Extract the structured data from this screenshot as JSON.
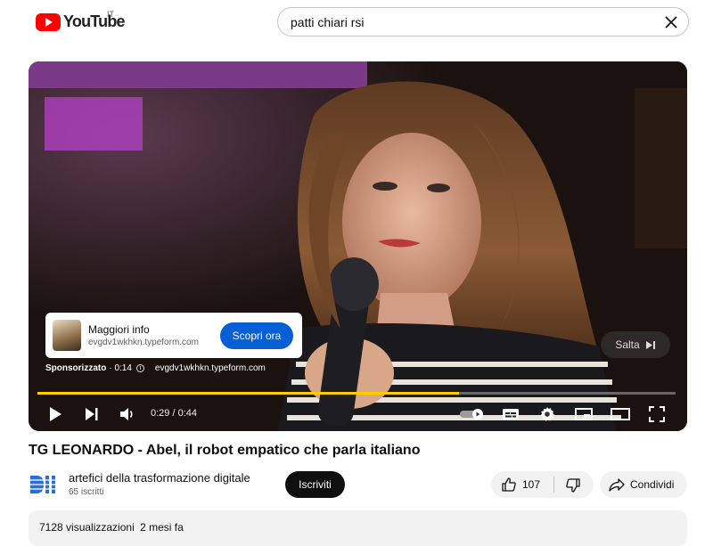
{
  "header": {
    "logo_text": "YouTube",
    "country_code": "IT",
    "search_value": "patti chiari rsi"
  },
  "player": {
    "ad": {
      "title": "Maggiori info",
      "url": "evgdv1wkhkn.typeform.com",
      "cta_label": "Scopri ora",
      "sponsored_label": "Sponsorizzato",
      "ad_time": "· 0:14",
      "info_url": "evgdv1wkhkn.typeform.com",
      "skip_label": "Salta"
    },
    "current_time": "0:29",
    "duration": "0:44",
    "time_display": "0:29 / 0:44",
    "progress": 0.66,
    "progress_color": "#ffcc00"
  },
  "video": {
    "title": "TG LEONARDO - Abel, il robot empatico che parla italiano",
    "channel": {
      "name": "artefici della trasformazione digitale",
      "subscribers": "65 iscritti",
      "subscribe_label": "Iscriviti"
    },
    "like_count": "107",
    "share_label": "Condividi",
    "views": "7128 visualizzazioni",
    "date": "2 mesi fa"
  },
  "colors": {
    "brand": "#ff0000",
    "cta": "#065fd4"
  }
}
